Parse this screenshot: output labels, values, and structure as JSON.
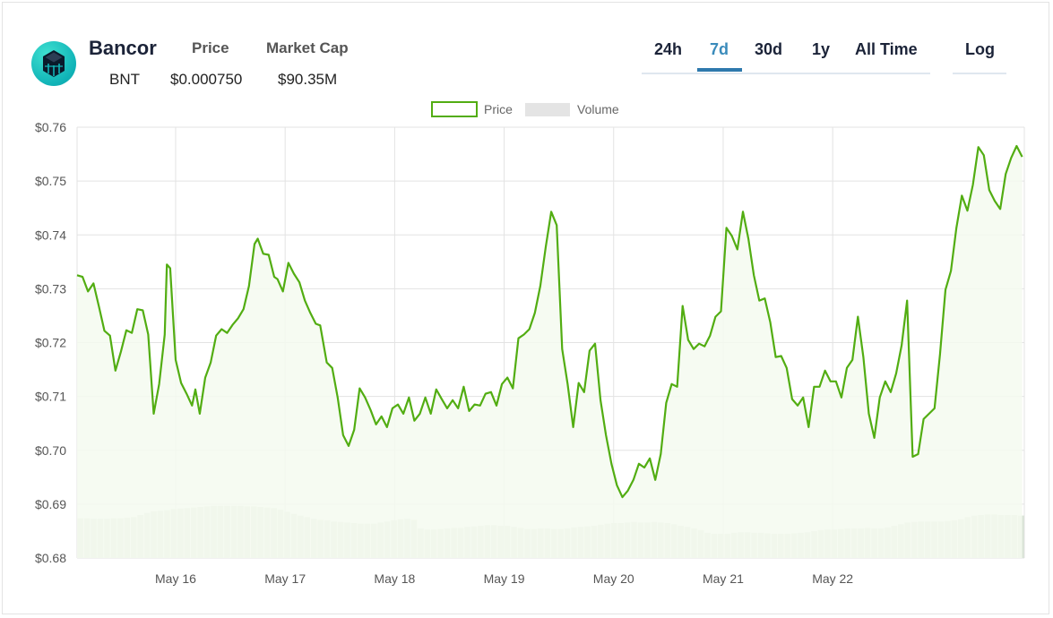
{
  "header": {
    "coin_name": "Bancor",
    "coin_symbol": "BNT",
    "price_label": "Price",
    "price_value": "$0.000750",
    "market_cap_label": "Market Cap",
    "market_cap_value": "$90.35M"
  },
  "range_tabs": {
    "items": [
      {
        "label": "24h",
        "active": false
      },
      {
        "label": "7d",
        "active": true
      },
      {
        "label": "30d",
        "active": false
      },
      {
        "label": "1y",
        "active": false
      },
      {
        "label": "All Time",
        "active": false
      }
    ],
    "log_label": "Log"
  },
  "colors": {
    "price_line": "#52ad12",
    "price_fill": "#f4faf0",
    "volume_bar": "#d9e4d6",
    "grid": "#e3e3e3",
    "active_tab": "#3a8bbb",
    "logo": "#10b3b7"
  },
  "chart_data": {
    "type": "line",
    "legend": [
      "Price",
      "Volume"
    ],
    "legend_position": "top-center",
    "grid": true,
    "ylim": [
      0.68,
      0.76
    ],
    "yticks": [
      "$0.76",
      "$0.75",
      "$0.74",
      "$0.73",
      "$0.72",
      "$0.71",
      "$0.70",
      "$0.69",
      "$0.68"
    ],
    "xlim": [
      15.1,
      22.95
    ],
    "xticks": [
      {
        "label": "May 16",
        "x": 16
      },
      {
        "label": "May 17",
        "x": 17
      },
      {
        "label": "May 18",
        "x": 18
      },
      {
        "label": "May 19",
        "x": 19
      },
      {
        "label": "May 20",
        "x": 20
      },
      {
        "label": "May 21",
        "x": 21
      },
      {
        "label": "May 22",
        "x": 22
      }
    ],
    "x_unit": "day of May",
    "series": [
      {
        "name": "Price",
        "points": [
          [
            15.1,
            0.7325
          ],
          [
            15.15,
            0.7322
          ],
          [
            15.2,
            0.7295
          ],
          [
            15.25,
            0.731
          ],
          [
            15.3,
            0.7267
          ],
          [
            15.35,
            0.7222
          ],
          [
            15.4,
            0.7213
          ],
          [
            15.45,
            0.7148
          ],
          [
            15.5,
            0.7183
          ],
          [
            15.55,
            0.7223
          ],
          [
            15.6,
            0.7218
          ],
          [
            15.65,
            0.7262
          ],
          [
            15.7,
            0.726
          ],
          [
            15.75,
            0.7215
          ],
          [
            15.8,
            0.7068
          ],
          [
            15.85,
            0.7123
          ],
          [
            15.9,
            0.7215
          ],
          [
            15.92,
            0.7345
          ],
          [
            15.95,
            0.7338
          ],
          [
            16.0,
            0.7168
          ],
          [
            16.05,
            0.7125
          ],
          [
            16.1,
            0.7105
          ],
          [
            16.15,
            0.7083
          ],
          [
            16.18,
            0.7113
          ],
          [
            16.22,
            0.7068
          ],
          [
            16.27,
            0.7135
          ],
          [
            16.32,
            0.7163
          ],
          [
            16.37,
            0.7213
          ],
          [
            16.42,
            0.7225
          ],
          [
            16.47,
            0.7218
          ],
          [
            16.52,
            0.7233
          ],
          [
            16.57,
            0.7245
          ],
          [
            16.62,
            0.7262
          ],
          [
            16.67,
            0.7305
          ],
          [
            16.72,
            0.7383
          ],
          [
            16.75,
            0.7393
          ],
          [
            16.8,
            0.7365
          ],
          [
            16.85,
            0.7363
          ],
          [
            16.9,
            0.7322
          ],
          [
            16.93,
            0.7318
          ],
          [
            16.98,
            0.7295
          ],
          [
            17.03,
            0.7348
          ],
          [
            17.08,
            0.7328
          ],
          [
            17.13,
            0.7312
          ],
          [
            17.18,
            0.7278
          ],
          [
            17.23,
            0.7255
          ],
          [
            17.28,
            0.7235
          ],
          [
            17.32,
            0.7232
          ],
          [
            17.38,
            0.7163
          ],
          [
            17.43,
            0.7153
          ],
          [
            17.48,
            0.7098
          ],
          [
            17.53,
            0.7028
          ],
          [
            17.58,
            0.7008
          ],
          [
            17.63,
            0.7038
          ],
          [
            17.68,
            0.7115
          ],
          [
            17.73,
            0.7098
          ],
          [
            17.78,
            0.7075
          ],
          [
            17.83,
            0.7048
          ],
          [
            17.88,
            0.7063
          ],
          [
            17.93,
            0.7043
          ],
          [
            17.98,
            0.7078
          ],
          [
            18.03,
            0.7085
          ],
          [
            18.08,
            0.7068
          ],
          [
            18.13,
            0.7098
          ],
          [
            18.18,
            0.7055
          ],
          [
            18.23,
            0.7068
          ],
          [
            18.28,
            0.7098
          ],
          [
            18.33,
            0.7068
          ],
          [
            18.38,
            0.7113
          ],
          [
            18.43,
            0.7095
          ],
          [
            18.48,
            0.7078
          ],
          [
            18.53,
            0.7093
          ],
          [
            18.58,
            0.7078
          ],
          [
            18.63,
            0.7118
          ],
          [
            18.68,
            0.7073
          ],
          [
            18.73,
            0.7085
          ],
          [
            18.78,
            0.7083
          ],
          [
            18.83,
            0.7105
          ],
          [
            18.88,
            0.7108
          ],
          [
            18.93,
            0.7083
          ],
          [
            18.98,
            0.7123
          ],
          [
            19.03,
            0.7135
          ],
          [
            19.08,
            0.7115
          ],
          [
            19.13,
            0.7208
          ],
          [
            19.18,
            0.7215
          ],
          [
            19.23,
            0.7225
          ],
          [
            19.28,
            0.7255
          ],
          [
            19.33,
            0.7305
          ],
          [
            19.38,
            0.7378
          ],
          [
            19.43,
            0.7443
          ],
          [
            19.48,
            0.7418
          ],
          [
            19.53,
            0.7188
          ],
          [
            19.58,
            0.7123
          ],
          [
            19.63,
            0.7043
          ],
          [
            19.68,
            0.7125
          ],
          [
            19.73,
            0.7108
          ],
          [
            19.78,
            0.7185
          ],
          [
            19.83,
            0.7198
          ],
          [
            19.88,
            0.7093
          ],
          [
            19.93,
            0.7028
          ],
          [
            19.98,
            0.6975
          ],
          [
            20.03,
            0.6935
          ],
          [
            20.08,
            0.6913
          ],
          [
            20.13,
            0.6925
          ],
          [
            20.18,
            0.6945
          ],
          [
            20.23,
            0.6975
          ],
          [
            20.28,
            0.6968
          ],
          [
            20.33,
            0.6985
          ],
          [
            20.38,
            0.6945
          ],
          [
            20.43,
            0.6993
          ],
          [
            20.48,
            0.7088
          ],
          [
            20.53,
            0.7123
          ],
          [
            20.58,
            0.7118
          ],
          [
            20.63,
            0.7268
          ],
          [
            20.68,
            0.7205
          ],
          [
            20.73,
            0.7188
          ],
          [
            20.78,
            0.7198
          ],
          [
            20.83,
            0.7193
          ],
          [
            20.88,
            0.7213
          ],
          [
            20.93,
            0.7248
          ],
          [
            20.98,
            0.7258
          ],
          [
            21.03,
            0.7413
          ],
          [
            21.08,
            0.7398
          ],
          [
            21.13,
            0.7373
          ],
          [
            21.18,
            0.7443
          ],
          [
            21.23,
            0.7393
          ],
          [
            21.28,
            0.7325
          ],
          [
            21.33,
            0.7278
          ],
          [
            21.38,
            0.7282
          ],
          [
            21.43,
            0.7238
          ],
          [
            21.48,
            0.7173
          ],
          [
            21.53,
            0.7175
          ],
          [
            21.58,
            0.7153
          ],
          [
            21.63,
            0.7095
          ],
          [
            21.68,
            0.7083
          ],
          [
            21.73,
            0.7098
          ],
          [
            21.78,
            0.7043
          ],
          [
            21.83,
            0.7118
          ],
          [
            21.88,
            0.7118
          ],
          [
            21.93,
            0.7148
          ],
          [
            21.98,
            0.7128
          ],
          [
            22.03,
            0.7128
          ],
          [
            22.08,
            0.7098
          ],
          [
            22.13,
            0.7153
          ],
          [
            22.18,
            0.7168
          ],
          [
            22.23,
            0.7248
          ],
          [
            22.28,
            0.7173
          ],
          [
            22.33,
            0.7068
          ],
          [
            22.38,
            0.7023
          ],
          [
            22.43,
            0.7098
          ],
          [
            22.48,
            0.7128
          ],
          [
            22.53,
            0.7108
          ],
          [
            22.58,
            0.7143
          ],
          [
            22.63,
            0.7195
          ],
          [
            22.68,
            0.7278
          ],
          [
            22.73,
            0.6988
          ],
          [
            22.78,
            0.6993
          ],
          [
            22.83,
            0.7058
          ],
          [
            22.88,
            0.7068
          ],
          [
            22.93,
            0.7078
          ],
          [
            22.98,
            0.7178
          ],
          [
            23.03,
            0.7298
          ],
          [
            23.08,
            0.7333
          ],
          [
            23.13,
            0.7413
          ],
          [
            23.18,
            0.7473
          ],
          [
            23.23,
            0.7445
          ],
          [
            23.28,
            0.7493
          ],
          [
            23.33,
            0.7563
          ],
          [
            23.38,
            0.7548
          ],
          [
            23.43,
            0.7483
          ],
          [
            23.48,
            0.7463
          ],
          [
            23.53,
            0.7448
          ],
          [
            23.58,
            0.7513
          ],
          [
            23.63,
            0.7543
          ],
          [
            23.68,
            0.7565
          ],
          [
            23.73,
            0.7545
          ]
        ]
      }
    ],
    "volume_relative": [
      0.74,
      0.74,
      0.73,
      0.73,
      0.73,
      0.74,
      0.74,
      0.75,
      0.76,
      0.8,
      0.84,
      0.87,
      0.88,
      0.89,
      0.91,
      0.92,
      0.93,
      0.94,
      0.95,
      0.96,
      0.97,
      0.97,
      0.97,
      0.97,
      0.97,
      0.96,
      0.96,
      0.95,
      0.94,
      0.93,
      0.9,
      0.86,
      0.82,
      0.79,
      0.76,
      0.73,
      0.71,
      0.7,
      0.68,
      0.67,
      0.66,
      0.65,
      0.64,
      0.64,
      0.64,
      0.66,
      0.68,
      0.7,
      0.72,
      0.73,
      0.71,
      0.55,
      0.53,
      0.53,
      0.54,
      0.55,
      0.56,
      0.56,
      0.58,
      0.59,
      0.6,
      0.61,
      0.61,
      0.6,
      0.6,
      0.58,
      0.56,
      0.54,
      0.54,
      0.55,
      0.55,
      0.54,
      0.54,
      0.55,
      0.57,
      0.58,
      0.59,
      0.6,
      0.62,
      0.64,
      0.65,
      0.65,
      0.66,
      0.67,
      0.66,
      0.66,
      0.67,
      0.66,
      0.65,
      0.63,
      0.6,
      0.58,
      0.55,
      0.52,
      0.47,
      0.45,
      0.45,
      0.45,
      0.47,
      0.48,
      0.48,
      0.47,
      0.47,
      0.46,
      0.45,
      0.45,
      0.45,
      0.46,
      0.47,
      0.48,
      0.5,
      0.52,
      0.53,
      0.53,
      0.54,
      0.55,
      0.55,
      0.55,
      0.56,
      0.55,
      0.55,
      0.57,
      0.6,
      0.63,
      0.66,
      0.67,
      0.68,
      0.68,
      0.68,
      0.68,
      0.69,
      0.7,
      0.72,
      0.76,
      0.79,
      0.8,
      0.81,
      0.81,
      0.8,
      0.8,
      0.8,
      0.79
    ]
  }
}
